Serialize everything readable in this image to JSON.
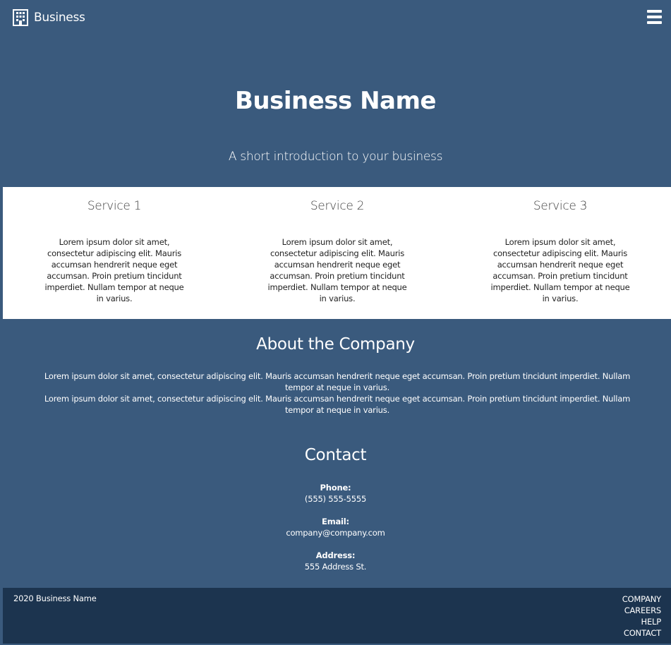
{
  "navbar": {
    "brand_label": "Business",
    "brand_icon": "building-icon",
    "menu_icon": "hamburger-menu-icon"
  },
  "hero": {
    "title": "Business Name",
    "subtitle": "A short introduction to your business"
  },
  "services": [
    {
      "title": "Service 1",
      "text": "Lorem ipsum dolor sit amet, consectetur adipiscing elit. Mauris accumsan hendrerit neque eget accumsan. Proin pretium tincidunt imperdiet. Nullam tempor at neque in varius."
    },
    {
      "title": "Service 2",
      "text": "Lorem ipsum dolor sit amet, consectetur adipiscing elit. Mauris accumsan hendrerit neque eget accumsan. Proin pretium tincidunt imperdiet. Nullam tempor at neque in varius."
    },
    {
      "title": "Service 3",
      "text": "Lorem ipsum dolor sit amet, consectetur adipiscing elit. Mauris accumsan hendrerit neque eget accumsan. Proin pretium tincidunt imperdiet. Nullam tempor at neque in varius."
    }
  ],
  "about": {
    "title": "About the Company",
    "paragraph_1": "Lorem ipsum dolor sit amet, consectetur adipiscing elit. Mauris accumsan hendrerit neque eget accumsan. Proin pretium tincidunt imperdiet. Nullam tempor at neque in varius.",
    "paragraph_2": "Lorem ipsum dolor sit amet, consectetur adipiscing elit. Mauris accumsan hendrerit neque eget accumsan. Proin pretium tincidunt imperdiet. Nullam tempor at neque in varius."
  },
  "contact": {
    "title": "Contact",
    "phone_label": "Phone:",
    "phone_value": "(555) 555-5555",
    "email_label": "Email:",
    "email_value": "company@company.com",
    "address_label": "Address:",
    "address_value": "555 Address St."
  },
  "footer": {
    "copyright": "2020 Business Name",
    "links": [
      "COMPANY",
      "CAREERS",
      "HELP",
      "CONTACT"
    ]
  },
  "colors": {
    "page_background": "#3a5a7d",
    "services_background": "#ffffff",
    "footer_background": "#1c344f"
  }
}
